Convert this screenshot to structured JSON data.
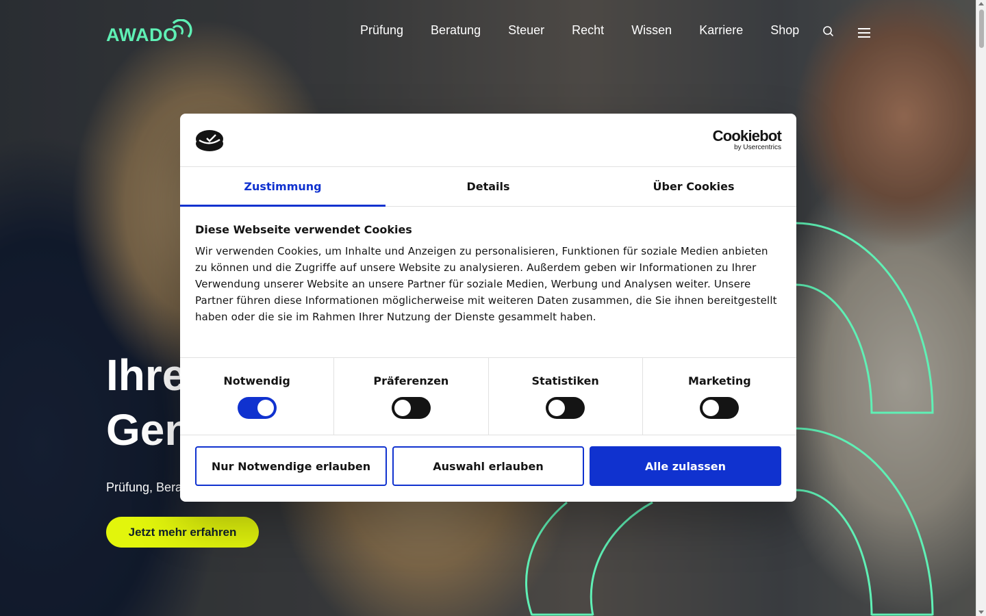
{
  "header": {
    "logo_text": "AWADO",
    "nav": [
      "Prüfung",
      "Beratung",
      "Steuer",
      "Recht",
      "Wissen",
      "Karriere",
      "Shop"
    ],
    "icons": [
      "search-icon",
      "menu-icon"
    ]
  },
  "hero": {
    "title_line1": "Ihre",
    "title_line2": "Gen",
    "subtitle": "Prüfung, Bera",
    "cta": "Jetzt mehr erfahren"
  },
  "cookie": {
    "brand": "Cookiebot",
    "brand_by": "by Usercentrics",
    "tabs": [
      {
        "label": "Zustimmung",
        "active": true
      },
      {
        "label": "Details",
        "active": false
      },
      {
        "label": "Über Cookies",
        "active": false
      }
    ],
    "title": "Diese Webseite verwendet Cookies",
    "text": "Wir verwenden Cookies, um Inhalte und Anzeigen zu personalisieren, Funktionen für soziale Medien anbieten zu können und die Zugriffe auf unsere Website zu analysieren. Außerdem geben wir Informationen zu Ihrer Verwendung unserer Website an unsere Partner für soziale Medien, Werbung und Analysen weiter. Unsere Partner führen diese Informationen möglicherweise mit weiteren Daten zusammen, die Sie ihnen bereitgestellt haben oder die sie im Rahmen Ihrer Nutzung der Dienste gesammelt haben.",
    "toggles": [
      {
        "label": "Notwendig",
        "on": true
      },
      {
        "label": "Präferenzen",
        "on": false
      },
      {
        "label": "Statistiken",
        "on": false
      },
      {
        "label": "Marketing",
        "on": false
      }
    ],
    "buttons": {
      "necessary_only": "Nur Notwendige erlauben",
      "allow_selection": "Auswahl erlauben",
      "allow_all": "Alle zulassen"
    }
  },
  "colors": {
    "accent": "#1032cf",
    "brand_green": "#5ff0b5",
    "cta_yellow": "#e2f50c"
  }
}
